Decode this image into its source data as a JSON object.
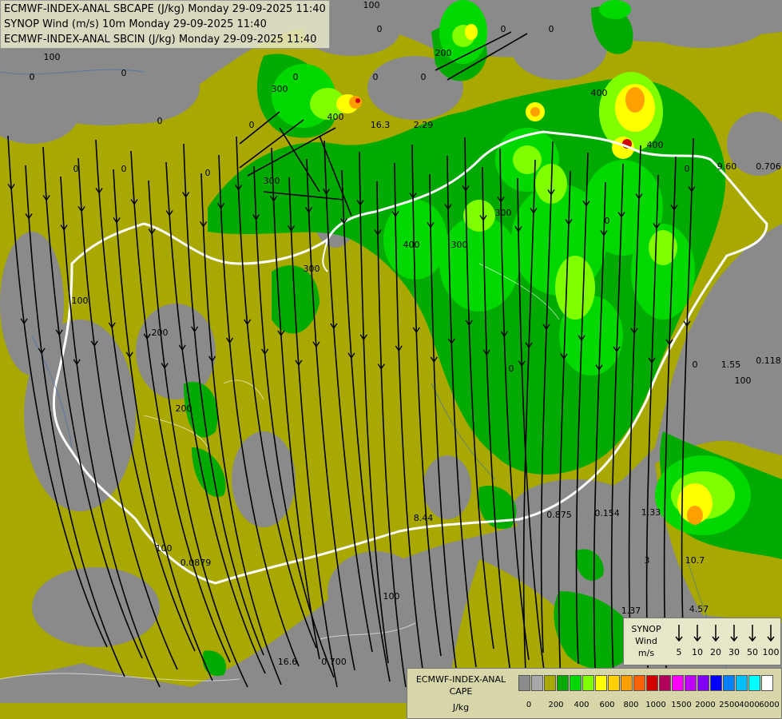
{
  "title": {
    "line1": "ECMWF-INDEX-ANAL SBCAPE (J/kg) Monday 29-09-2025 11:40",
    "line2": "SYNOP Wind (m/s) 10m Monday 29-09-2025 11:40",
    "line3": "ECMWF-INDEX-ANAL SBCIN (J/kg) Monday 29-09-2025 11:40"
  },
  "synop_legend": {
    "title_line1": "SYNOP",
    "title_line2": "Wind",
    "title_line3": "m/s",
    "speeds": [
      "5",
      "10",
      "20",
      "30",
      "50",
      "100"
    ]
  },
  "cape_legend": {
    "title_line1": "ECMWF-INDEX-ANAL",
    "title_line2": "CAPE",
    "unit": "J/kg",
    "colors": [
      "#8c8c8c",
      "#a8a8a8",
      "#a8a800",
      "#00aa00",
      "#00d800",
      "#80ff00",
      "#ffff00",
      "#ffd000",
      "#ffa000",
      "#ff6000",
      "#d00000",
      "#b0005a",
      "#ff00ff",
      "#c000ff",
      "#8000ff",
      "#0000ff",
      "#0080ff",
      "#00c0ff",
      "#00ffff",
      "#ffffff"
    ],
    "values": [
      "0",
      "200",
      "400",
      "600",
      "800",
      "1000",
      "1500",
      "2000",
      "2500",
      "4000",
      "6000"
    ]
  },
  "map_colors": {
    "background_gray": "#8a8a8a",
    "olive": "#a8a800",
    "green": "#00aa00",
    "light_green": "#00d800",
    "lime": "#80ff00",
    "yellow": "#ffff00",
    "orange": "#ffa000",
    "red": "#d00000",
    "border_white": "#ffffff",
    "streamline": "#000000"
  },
  "cin_labels": [
    "0",
    "0",
    "0",
    "0",
    "0",
    "0",
    "0",
    "0",
    "0",
    "0",
    "0",
    "0",
    "0",
    "0",
    "0",
    "0",
    "0",
    "100",
    "100",
    "100",
    "100",
    "100",
    "100",
    "200",
    "200",
    "200",
    "300",
    "300",
    "300",
    "300",
    "300",
    "400",
    "400",
    "400",
    "400",
    "16.3",
    "2.29",
    "9.60",
    "0.706",
    "0.118",
    "1.55",
    "8.44",
    "0.875",
    "0.154",
    "1.33",
    "0.0879",
    "10.7",
    "1.37",
    "4.57",
    "16.6",
    "0.700",
    "3"
  ]
}
